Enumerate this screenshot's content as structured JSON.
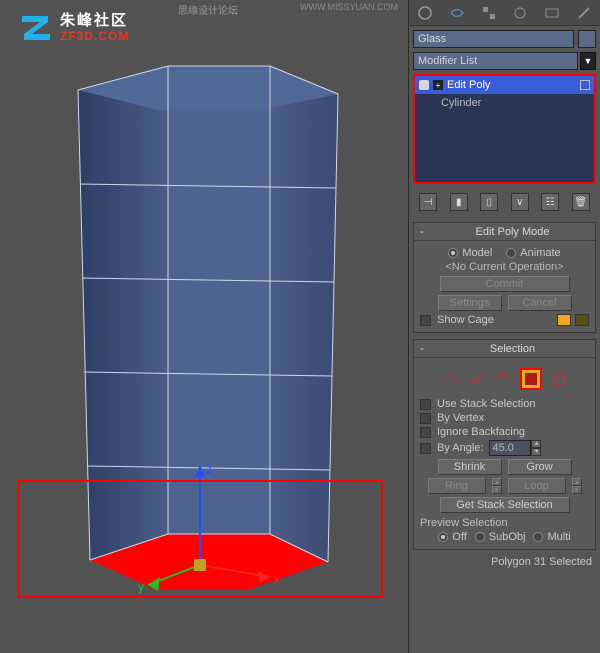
{
  "watermark": {
    "title": "思缘设计论坛",
    "url": "WWW.MISSYUAN.COM"
  },
  "logo": {
    "cn": "朱峰社区",
    "en": "ZF3D.COM"
  },
  "panel": {
    "object_name": "Glass",
    "modifier_list_label": "Modifier List",
    "stack": {
      "items": [
        {
          "label": "Edit Poly",
          "selected": true
        },
        {
          "label": "Cylinder",
          "selected": false
        }
      ]
    },
    "edit_poly_mode": {
      "title": "Edit Poly Mode",
      "model": "Model",
      "animate": "Animate",
      "no_op": "<No Current Operation>",
      "commit": "Commit",
      "settings": "Settings",
      "cancel": "Cancel",
      "show_cage": "Show Cage",
      "swatch1": "#f5a818",
      "swatch2": "#584c18"
    },
    "selection": {
      "title": "Selection",
      "use_stack": "Use Stack Selection",
      "by_vertex": "By Vertex",
      "ignore_backfacing": "Ignore Backfacing",
      "by_angle": "By Angle:",
      "angle_value": "45.0",
      "shrink": "Shrink",
      "grow": "Grow",
      "ring": "Ring",
      "loop": "Loop",
      "get_stack_selection": "Get Stack Selection"
    },
    "preview": {
      "title": "Preview Selection",
      "off": "Off",
      "subobj": "SubObj",
      "multi": "Multi"
    },
    "footer": "Polygon 31 Selected"
  }
}
